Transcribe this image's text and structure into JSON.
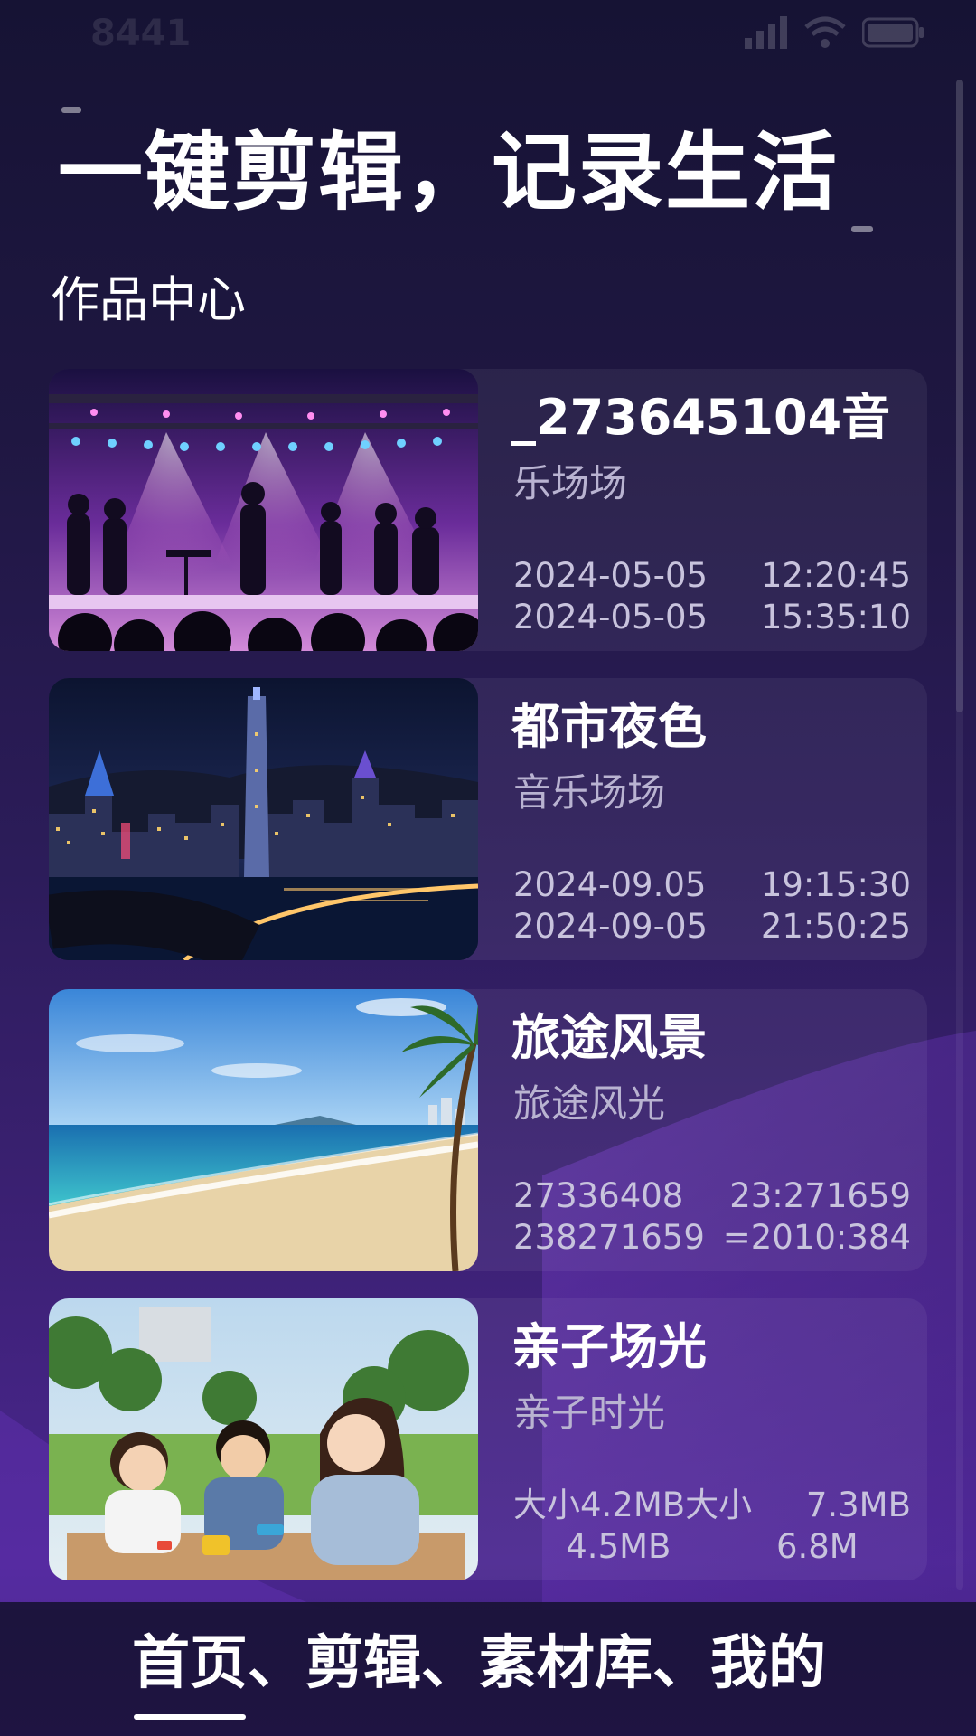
{
  "status_bar": {
    "time": "8441"
  },
  "header": {
    "title": "一键剪辑，记录生活"
  },
  "section": {
    "title": "作品中心"
  },
  "works": [
    {
      "title": "_273645104音",
      "subtitle": "乐场场",
      "thumbnail": "concert-stage-photo",
      "meta": [
        [
          "2024-05-05",
          "12:20:45"
        ],
        [
          "2024-05-05",
          "15:35:10"
        ]
      ]
    },
    {
      "title": "都市夜色",
      "subtitle": "音乐场场",
      "thumbnail": "city-night-skyline-photo",
      "meta": [
        [
          "2024-09.05",
          "19:15:30"
        ],
        [
          "2024-09-05",
          "21:50:25"
        ]
      ]
    },
    {
      "title": "旅途风景",
      "subtitle": "旅途风光",
      "thumbnail": "beach-landscape-photo",
      "meta": [
        [
          "27336408",
          "23:271659"
        ],
        [
          "238271659",
          "=2010:384"
        ]
      ]
    },
    {
      "title": "亲子场光",
      "subtitle": "亲子时光",
      "thumbnail": "family-children-photo",
      "meta": [
        [
          "大小4.2MB大小",
          "7.3MB"
        ],
        [
          "4.5MB",
          "6.8M"
        ]
      ]
    }
  ],
  "bottom_nav": {
    "label": "首页、剪辑、素材库、我的"
  },
  "colors": {
    "background_top": "#161334",
    "background_bottom": "#4a2690",
    "subtitle_text": "#b9b3d1",
    "meta_text": "#c8c3dd"
  }
}
